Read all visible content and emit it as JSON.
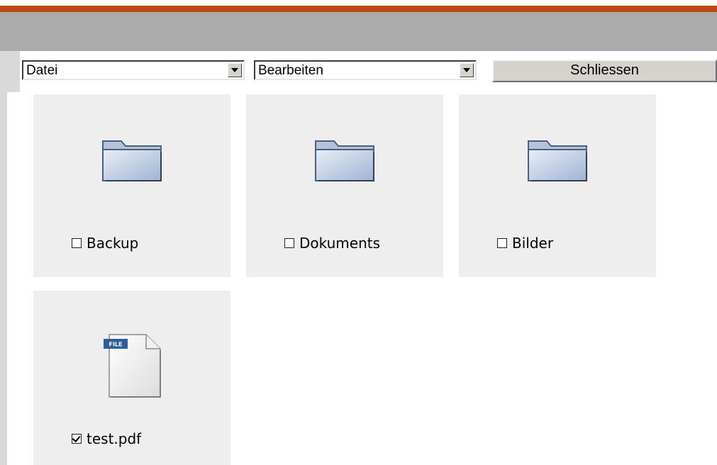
{
  "menu": {
    "file_label": "Datei",
    "edit_label": "Bearbeiten",
    "close_label": "Schliessen"
  },
  "items": [
    {
      "name": "Backup",
      "type": "folder",
      "checked": false
    },
    {
      "name": "Dokuments",
      "type": "folder",
      "checked": false
    },
    {
      "name": "Bilder",
      "type": "folder",
      "checked": false
    },
    {
      "name": "test.pdf",
      "type": "file",
      "checked": true
    }
  ],
  "file_badge": "FILE",
  "colors": {
    "accent": "#b94a12",
    "header": "#ababab",
    "tile": "#eeeeee"
  }
}
